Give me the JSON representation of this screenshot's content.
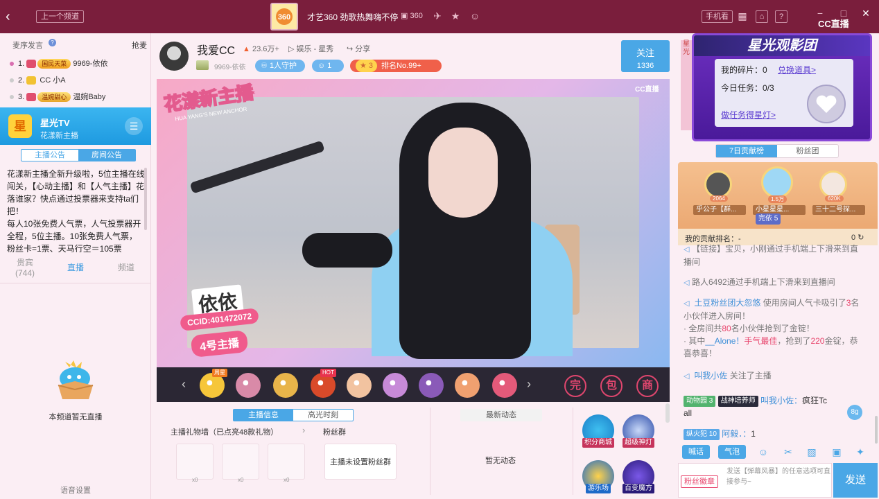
{
  "topbar": {
    "back_icon": "back-arrow-icon",
    "prev_channel": "上一个频道",
    "channel_title": "才艺360 劲歌热舞嗨不停",
    "channel_id": "360",
    "phone_view": "手机看",
    "brand": "CC直播",
    "logo_text": "360",
    "icons": [
      "channel-id-icon",
      "plane-icon",
      "star-icon",
      "users-icon",
      "grid-icon",
      "bell-icon",
      "help-icon",
      "minimize-icon",
      "maximize-icon",
      "close-icon"
    ]
  },
  "left": {
    "rank_header": "麦序发言",
    "rank_grab": "抢麦",
    "rank_list": [
      {
        "index": "1.",
        "badge": "国民天菜",
        "name": "9969-依依"
      },
      {
        "index": "2.",
        "badge": "",
        "name": "CC 小A"
      },
      {
        "index": "3.",
        "badge": "温婉甜心",
        "name": "温婉Baby"
      }
    ],
    "channel": {
      "logo": "星",
      "name": "星光TV",
      "sub": "花漾新主播"
    },
    "ann_tabs": [
      "主播公告",
      "房间公告"
    ],
    "announcement": "花漾新主播全新升级啦，5位主播在线闯关，【心动主播】和【人气主播】花落谁家？快点通过投票器来支持ta们把！\n每人10张免费人气票，人气投票器开全程，5位主播。10张免费人气票，粉丝卡=1票、天马行空＝105票",
    "bottom_tabs": [
      {
        "label": "贵宾",
        "count": "(744)"
      },
      {
        "label": "直播",
        "count": ""
      },
      {
        "label": "频道",
        "count": ""
      }
    ],
    "empty_text": "本频道暂无直播",
    "voice_settings": "语音设置"
  },
  "anchor": {
    "name": "我爱CC",
    "heat": "23.6万+",
    "category": "娱乐 - 星秀",
    "share": "分享",
    "guild": "9969-依依",
    "guard": "1人守护",
    "fans": "1",
    "level": "3",
    "rank": "排名No.99+",
    "follow_label": "关注",
    "follow_count": "1336"
  },
  "video": {
    "title": "花漾新主播",
    "subtitle": "HUA YANG'S NEW ANCHOR",
    "brand": "CC直播",
    "anchor_name": "依依",
    "ccid": "CCID:401472072",
    "number": "4号主播"
  },
  "giftbar": {
    "tags": [
      "周星",
      "HOT"
    ],
    "actions": [
      "完",
      "包",
      "商"
    ],
    "gift_colors": [
      "#f6c63a",
      "#d98aa8",
      "#e8b44a",
      "#d94a2a",
      "#f2c3a0",
      "#c78ad8",
      "#8a5ab8",
      "#f0a070",
      "#e45a7a"
    ]
  },
  "lower": {
    "tabs": [
      "主播信息",
      "高光时刻"
    ],
    "gift_wall": "主播礼物墙（已点亮48款礼物）",
    "fan_group": "粉丝群",
    "gift_counts": [
      "x0",
      "x0",
      "x0"
    ],
    "no_fan_group": "主播未设置粉丝群",
    "news_tab": "最新动态",
    "no_news": "暂无动态",
    "activities": [
      "积分商城",
      "超级神灯",
      "游乐场",
      "百变魔方"
    ]
  },
  "right": {
    "strip_text": "星光",
    "banner_title": "星光观影团",
    "my_fragments_label": "我的碎片：",
    "my_fragments_value": "0",
    "redeem": "兑换道具>",
    "task_label": "今日任务：",
    "task_value": "0/3",
    "do_task": "做任务得星灯>",
    "contrib_tabs": [
      "7日贡献榜",
      "粉丝团"
    ],
    "podium": [
      {
        "name": "乎公子【群...",
        "score": "2064"
      },
      {
        "name": "小星星星...",
        "score": "1.5万"
      },
      {
        "name": "三十二号探...",
        "score": "620K"
      }
    ],
    "podium_badge": "5",
    "podium_badge_label": "完依",
    "my_rank_label": "我的贡献排名：",
    "my_rank_value": "-",
    "my_rank_score": "0",
    "chat": {
      "m1": "【链接】宝贝，小刚通过手机端上下滑来到直播间",
      "m2": "路人6492通过手机端上下滑来到直播间",
      "m3_user": "土豆粉丝团大忽悠",
      "m3_text": "使用房间人气卡吸引了",
      "m3_num": "3",
      "m3_tail": "名小伙伴进入房间！",
      "m3_l2a": "全房间共",
      "m3_num2": "80",
      "m3_l2b": "名小伙伴抢到了金锭！",
      "m3_l3a": "其中",
      "m3_user2": "__Alone！",
      "m3_l3b": "手气最佳",
      "m3_l3c": "，抢到了",
      "m3_num3": "220",
      "m3_l3d": "金锭，恭喜恭喜！",
      "m4_user": "叫我小佐",
      "m4_text": "关注了主播",
      "m5_badge1": "动物园",
      "m5_badge1_lv": "3",
      "m5_badge2": "战神培养师",
      "m5_user": "叫我小佐：",
      "m5_text": "疯狂Tc",
      "m5_l2": "all",
      "m5_bubble": "8g",
      "m6_badge": "纵火犯",
      "m6_lv": "10",
      "m6_user": "阿毅．：",
      "m6_text": "1"
    },
    "tools": {
      "shout": "喊话",
      "bubble": "气泡"
    },
    "fan_badge_btn": "粉丝徽章",
    "input_placeholder": "发送【弹幕风暴】的任意选项可直接参与~",
    "send": "发送"
  }
}
